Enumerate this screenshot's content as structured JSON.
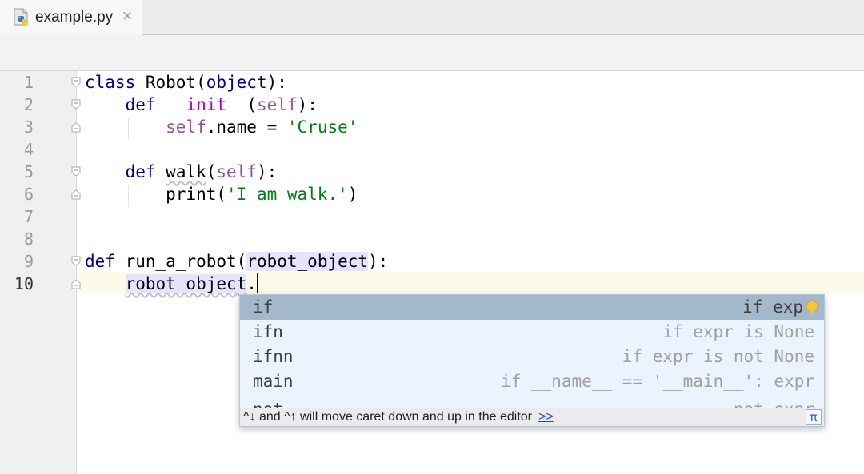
{
  "tab": {
    "title": "example.py",
    "close_glyph": "×",
    "icon": "python-file-icon"
  },
  "gutter": {
    "line_numbers": [
      "1",
      "2",
      "3",
      "4",
      "5",
      "6",
      "7",
      "8",
      "9",
      "10"
    ],
    "current_line": 10
  },
  "code": {
    "line1": {
      "kw": "class",
      "rest1": " Robot(",
      "builtin": "object",
      "rest2": "):"
    },
    "line2": {
      "indent": "    ",
      "kw": "def",
      "sp": " ",
      "magic": "__init__",
      "p1": "(",
      "self": "self",
      "p2": "):"
    },
    "line3": {
      "indent": "        ",
      "self": "self",
      "rest": ".name = ",
      "str": "'Cruse'"
    },
    "line5": {
      "indent": "    ",
      "kw": "def",
      "sp": " ",
      "name": "walk",
      "p1": "(",
      "self": "self",
      "p2": "):"
    },
    "line6": {
      "indent": "        ",
      "call": "print(",
      "str": "'I am walk.'",
      "close": ")"
    },
    "line9": {
      "kw": "def",
      "rest": " run_a_robot(",
      "param": "robot_object",
      "close": "):"
    },
    "line10": {
      "indent": "    ",
      "param": "robot_object",
      "dot": "."
    }
  },
  "completion": {
    "items": [
      {
        "name": "if",
        "desc": "if exp",
        "selected": true
      },
      {
        "name": "ifn",
        "desc": "if expr is None",
        "selected": false
      },
      {
        "name": "ifnn",
        "desc": "if expr is not None",
        "selected": false
      },
      {
        "name": "main",
        "desc": "if __name__ == '__main__': expr",
        "selected": false
      },
      {
        "name": "not",
        "desc": "not expr",
        "selected": false
      }
    ],
    "hint": "^↓ and ^↑ will move caret down and up in the editor",
    "hint_link": ">>",
    "pi_button": "π",
    "bulb_icon": "lightbulb-icon"
  },
  "colors": {
    "keyword": "#000080",
    "self": "#94558d",
    "magic": "#b200b2",
    "string": "#067d17",
    "selection": "#a4b8cc",
    "popup_bg": "#ebf4fe"
  }
}
